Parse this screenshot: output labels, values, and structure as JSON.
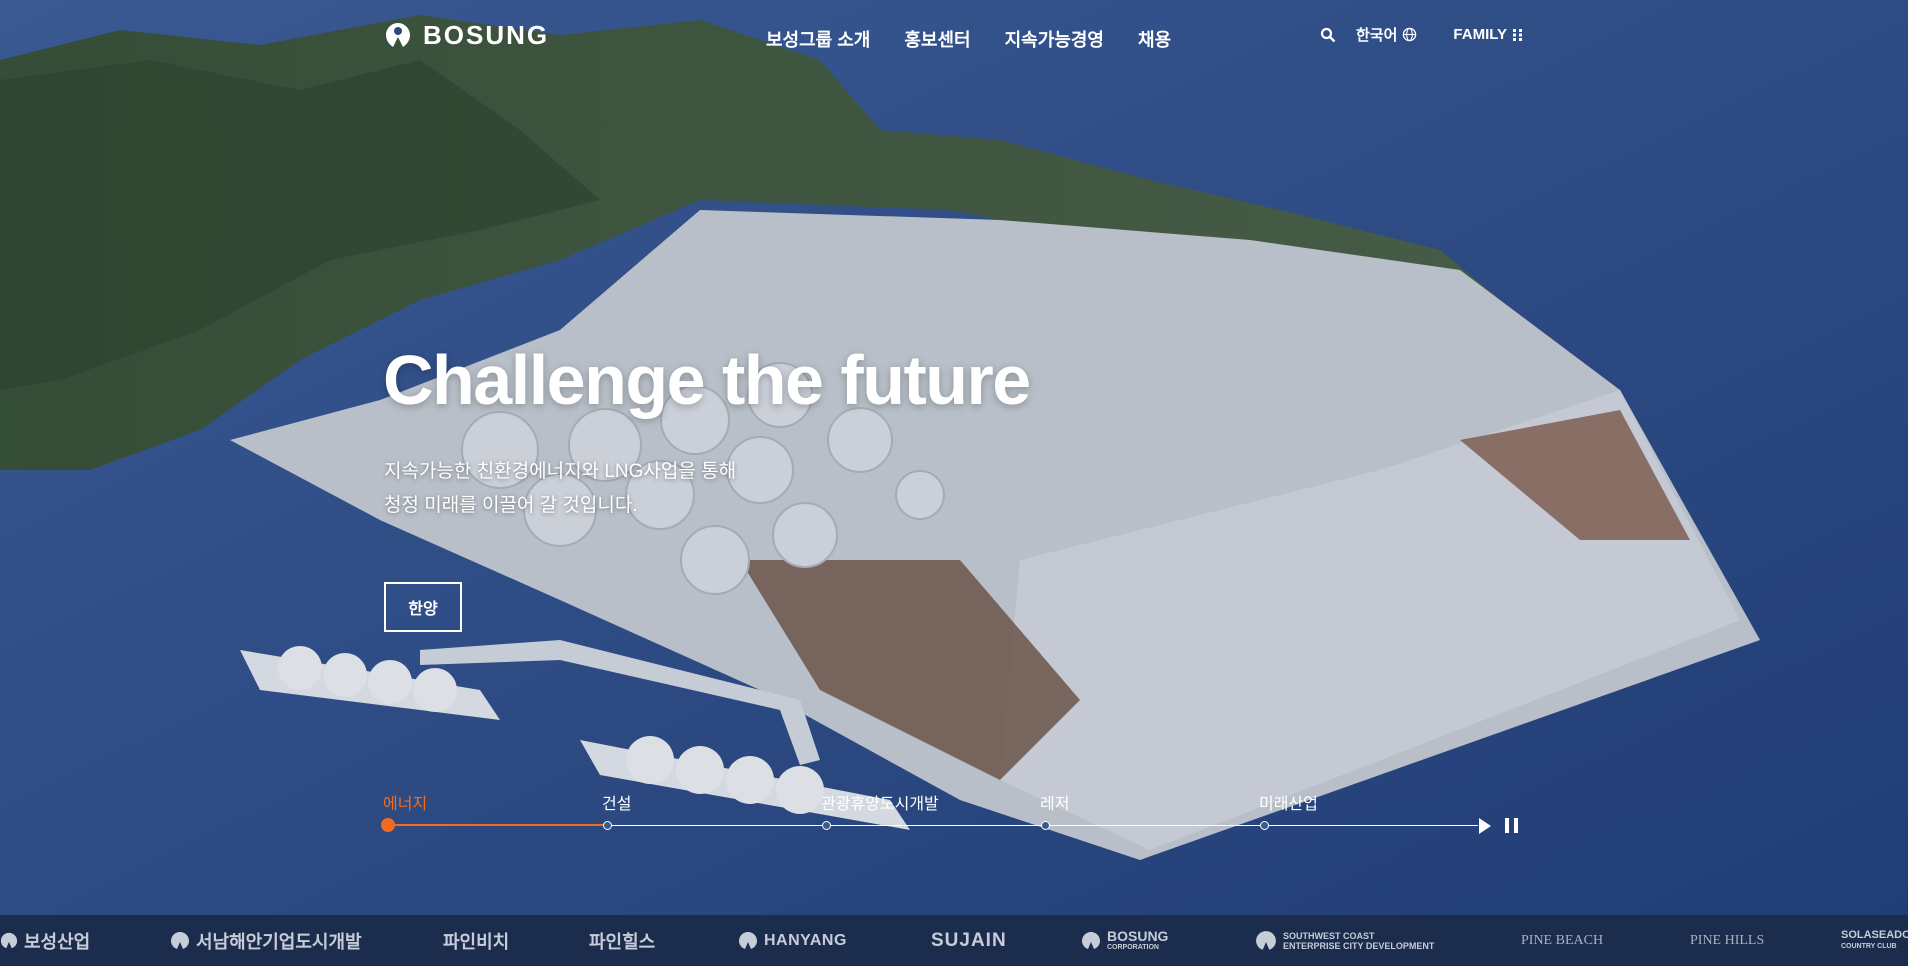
{
  "header": {
    "logo_text": "BOSUNG",
    "nav": [
      "보성그룹 소개",
      "홍보센터",
      "지속가능경영",
      "채용"
    ],
    "language_label": "한국어",
    "family_label": "FAMILY"
  },
  "hero": {
    "headline": "Challenge the future",
    "subtitle_lines": [
      "지속가능한 친환경에너지와 LNG사업을 통해",
      "청정 미래를 이끌어 갈 것입니다."
    ],
    "cta_label": "한양"
  },
  "timeline": {
    "items": [
      "에너지",
      "건설",
      "관광휴양도시개발",
      "레저",
      "미래산업"
    ],
    "active_index": 0,
    "accent_color": "#f26b1d"
  },
  "footer": {
    "family_sites": [
      "보성산업",
      "서남해안기업도시개발",
      "파인비치",
      "파인힐스",
      "HANYANG",
      "SUJAIN",
      "BOSUNG",
      "SOUTHWEST COAST",
      "PINE BEACH",
      "PINE HILLS",
      "SOLASEADO"
    ],
    "family_site_sublabels": {
      "bosung_corp": "CORPORATION",
      "southwest": "ENTERPRISE CITY DEVELOPMENT",
      "solaseado": "COUNTRY CLUB"
    }
  }
}
